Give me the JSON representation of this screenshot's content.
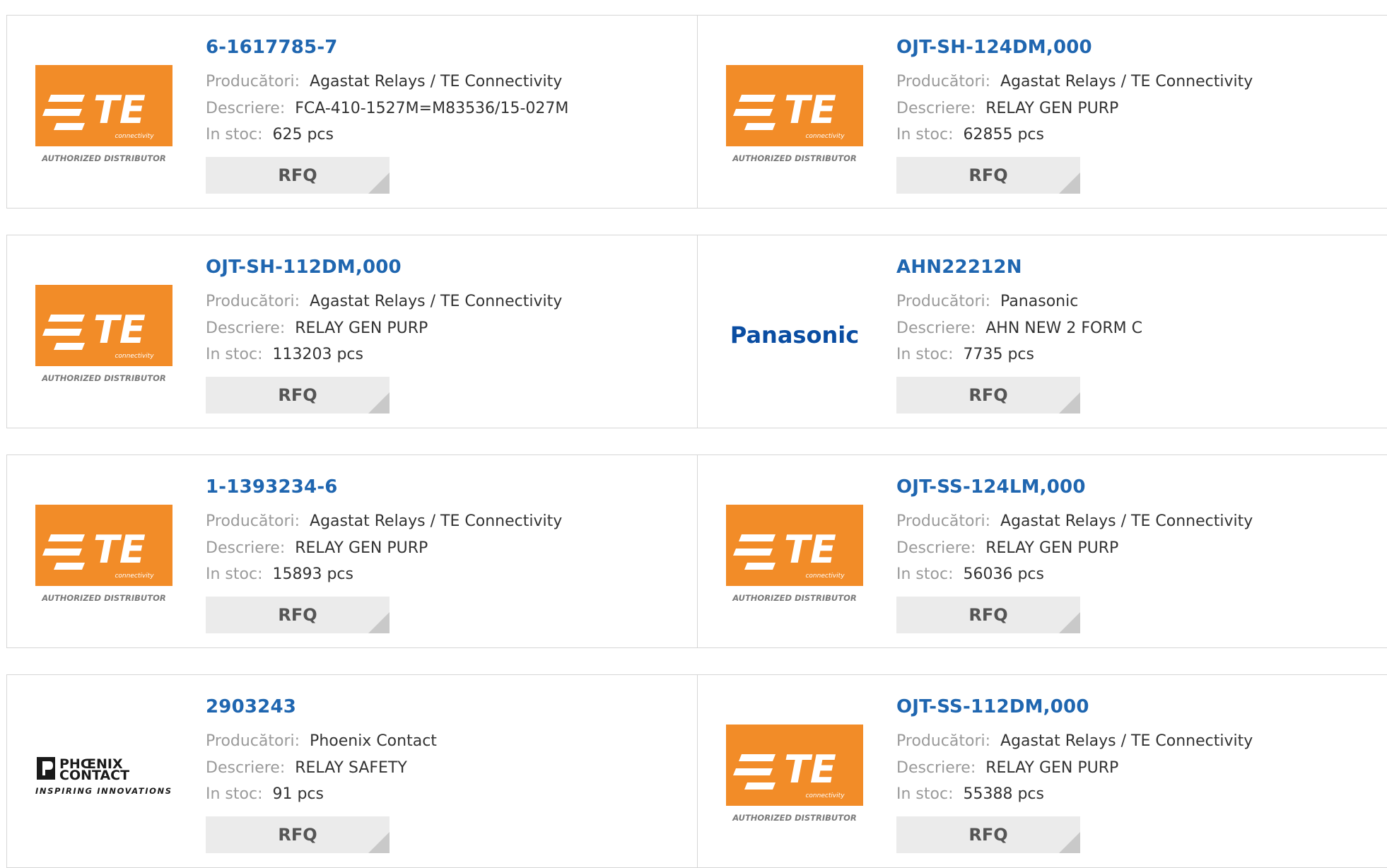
{
  "labels": {
    "manufacturer": "Producători:",
    "description": "Descriere:",
    "stock": "In stoc:",
    "rfq": "RFQ"
  },
  "logos": {
    "te": {
      "mark": "TE",
      "sub": "connectivity",
      "caption": "AUTHORIZED DISTRIBUTOR",
      "color": "#f28c28"
    },
    "panasonic": {
      "text": "Panasonic",
      "color": "#0a4da2"
    },
    "phoenix": {
      "line1": "PHŒNIX",
      "line2": "CONTACT",
      "tagline": "INSPIRING INNOVATIONS"
    }
  },
  "products": [
    {
      "part": "6-1617785-7",
      "manufacturer": "Agastat Relays / TE Connectivity",
      "description": "FCA-410-1527M=M83536/15-027M",
      "stock": "625 pcs",
      "logo": "te"
    },
    {
      "part": "OJT-SH-124DM,000",
      "manufacturer": "Agastat Relays / TE Connectivity",
      "description": "RELAY GEN PURP",
      "stock": "62855 pcs",
      "logo": "te"
    },
    {
      "part": "OJT-SH-112DM,000",
      "manufacturer": "Agastat Relays / TE Connectivity",
      "description": "RELAY GEN PURP",
      "stock": "113203 pcs",
      "logo": "te"
    },
    {
      "part": "AHN22212N",
      "manufacturer": "Panasonic",
      "description": "AHN NEW 2 FORM C",
      "stock": "7735 pcs",
      "logo": "panasonic"
    },
    {
      "part": "1-1393234-6",
      "manufacturer": "Agastat Relays / TE Connectivity",
      "description": "RELAY GEN PURP",
      "stock": "15893 pcs",
      "logo": "te"
    },
    {
      "part": "OJT-SS-124LM,000",
      "manufacturer": "Agastat Relays / TE Connectivity",
      "description": "RELAY GEN PURP",
      "stock": "56036 pcs",
      "logo": "te"
    },
    {
      "part": "2903243",
      "manufacturer": "Phoenix Contact",
      "description": "RELAY SAFETY",
      "stock": "91 pcs",
      "logo": "phoenix"
    },
    {
      "part": "OJT-SS-112DM,000",
      "manufacturer": "Agastat Relays / TE Connectivity",
      "description": "RELAY GEN PURP",
      "stock": "55388 pcs",
      "logo": "te"
    }
  ]
}
